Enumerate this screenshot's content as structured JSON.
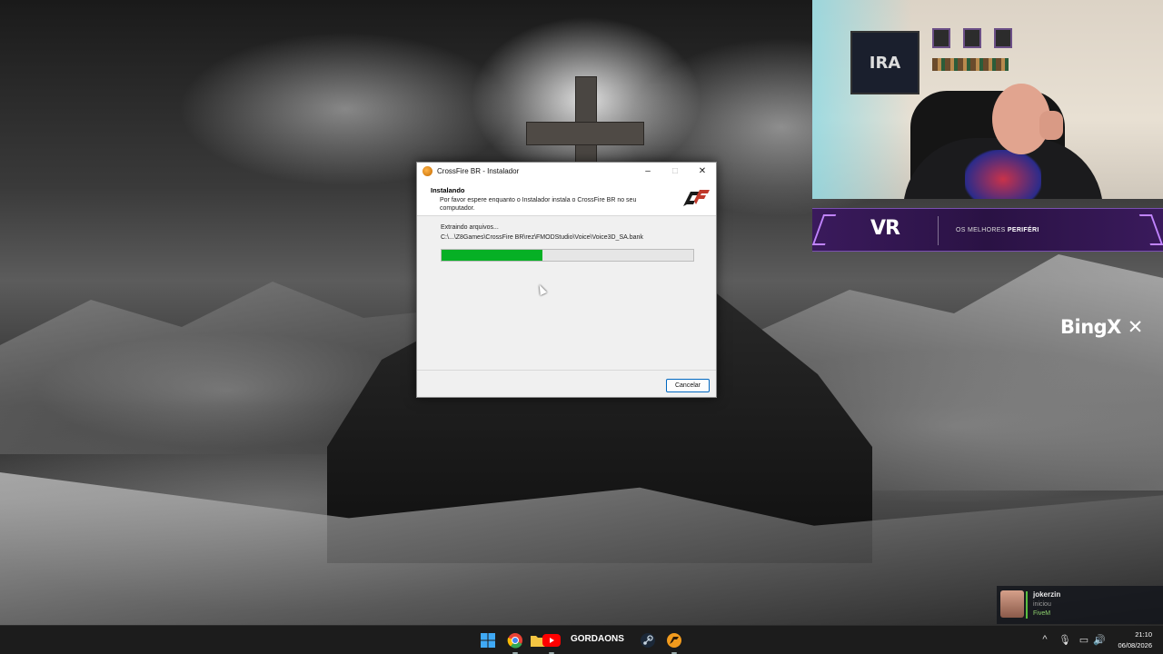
{
  "installer": {
    "title": "CrossFire BR - Instalador",
    "minimize_glyph": "–",
    "maximize_glyph": "□",
    "close_glyph": "✕",
    "header_title": "Instalando",
    "header_desc": "Por favor espere enquanto o Instalador instala o CrossFire BR no seu computador.",
    "status": "Extraindo arquivos...",
    "current_path": "C:\\...\\Z8Games\\CrossFire BR\\rez\\FMODStudio\\Voice\\Voice3D_SA.bank",
    "progress_fraction": 0.4,
    "cancel_label": "Cancelar",
    "progress_color": "#06b025"
  },
  "webcam": {
    "poster_text": "IRA"
  },
  "banner": {
    "logo": "VR",
    "tagline_prefix": "OS MELHORES ",
    "tagline_bold": "PERIFÉRI"
  },
  "sponsor": {
    "name": "BingX"
  },
  "notification": {
    "user": "jokerzin",
    "action": "iniciou",
    "game": "FiveM",
    "accent": "#59bf40"
  },
  "taskbar": {
    "icons": [
      "windows-start",
      "chrome",
      "file-explorer",
      "youtube",
      "steam",
      "crossfire"
    ],
    "youtube_badge_text": "GORDAONS",
    "time": "21:10",
    "date": "06/08/2026"
  }
}
